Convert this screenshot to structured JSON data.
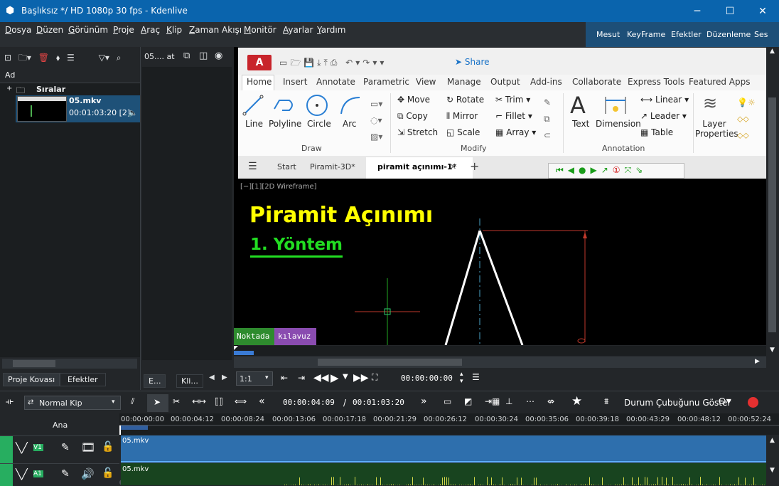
{
  "window": {
    "title": "Başlıksız */ HD 1080p 30 fps - Kdenlive",
    "controls": [
      "─",
      "☐",
      "✕"
    ]
  },
  "menu": [
    "Dosya",
    "Düzen",
    "Görünüm",
    "Proje",
    "Araç",
    "Klip",
    "Zaman Akışı",
    "Monitör",
    "Ayarlar",
    "Yardım"
  ],
  "layouts": [
    "Mesut",
    "KeyFrame",
    "Efektler",
    "Düzenleme",
    "Ses"
  ],
  "bin": {
    "header": "Ad",
    "folder": "Sıralar",
    "clip_name": "05.mkv",
    "clip_duration": "00:01:03:20 [2]",
    "tab_bin": "Proje Kovası",
    "tab_effects": "Efektler"
  },
  "clip_monitor": {
    "title": "05.... at",
    "tab1": "E...",
    "tab2": "Kli..."
  },
  "autocad": {
    "logo": "A",
    "share": "Share",
    "tabs": [
      "Home",
      "Insert",
      "Annotate",
      "Parametric",
      "View",
      "Manage",
      "Output",
      "Add-ins",
      "Collaborate",
      "Express Tools",
      "Featured Apps"
    ],
    "draw_tools": [
      "Line",
      "Polyline",
      "Circle",
      "Arc"
    ],
    "modify_tools": [
      "Move",
      "Rotate",
      "Trim",
      "Copy",
      "Mirror",
      "Fillet",
      "Stretch",
      "Scale",
      "Array"
    ],
    "annotation": {
      "text": "Text",
      "dimension": "Dimension",
      "linear": "Linear",
      "leader": "Leader",
      "table": "Table"
    },
    "layers": "Layer Properties",
    "groups": {
      "draw": "Draw",
      "modify": "Modify",
      "annotation": "Annotation"
    },
    "file_tabs": [
      "Start",
      "Piramit-3D*",
      "piramit açınımı-1*"
    ],
    "viewport_label": "[−][1][2D Wireframe]",
    "title": "Piramit Açınımı",
    "subtitle": "1. Yöntem"
  },
  "overlay": {
    "left": "Noktada",
    "right": "kılavuz"
  },
  "monitor": {
    "zoom": "1:1",
    "timecode": "00:00:00:00"
  },
  "timeline_toolbar": {
    "mode": "Normal Kip",
    "position": "00:00:04:09",
    "duration": "00:01:03:20",
    "status": "Durum Çubuğunu Göster"
  },
  "ruler": [
    "00:00:00:00",
    "00:00:04:12",
    "00:00:08:24",
    "00:00:13:06",
    "00:00:17:18",
    "00:00:21:29",
    "00:00:26:12",
    "00:00:30:24",
    "00:00:35:06",
    "00:00:39:18",
    "00:00:43:29",
    "00:00:48:12",
    "00:00:52:24"
  ],
  "tracks": {
    "master": "Ana",
    "v1": "V1",
    "a1": "A1",
    "clip": "05.mkv"
  },
  "colors": {
    "title_blue": "#0a64ad",
    "clip_blue": "#2e6fad",
    "track_green": "#27ae60",
    "yellow_text": "#ffff00",
    "green_text": "#22dd22",
    "overlay_green": "#2e8b2e",
    "overlay_purple": "#8a4cb0"
  }
}
